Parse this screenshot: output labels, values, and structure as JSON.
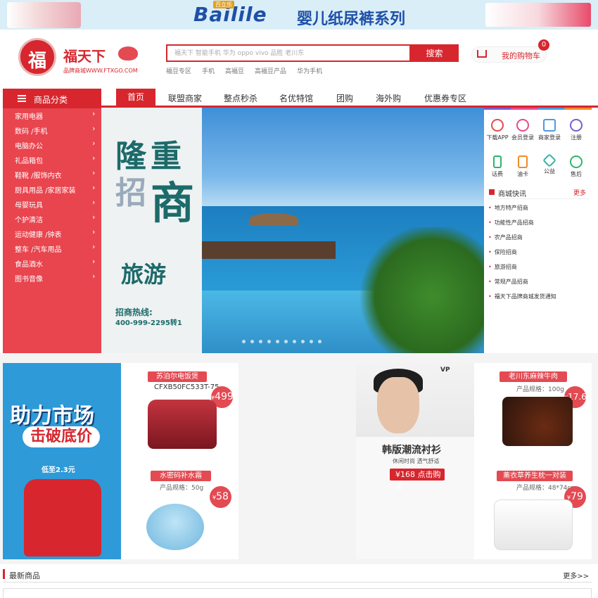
{
  "banner": {
    "brand": "Bailile",
    "brand_sub": "百立乐",
    "slogan": "婴儿纸尿裤系列"
  },
  "header": {
    "logo_char": "福",
    "logo_name": "福天下",
    "logo_sub": "品牌商城WWW.FTXGO.COM",
    "search_placeholder": "福天下 智能手机 华为 oppo vivo 品胜 老川东",
    "search_button": "搜索",
    "hot_links": [
      "福豆专区",
      "手机",
      "高福豆",
      "高福豆产品",
      "华为手机"
    ],
    "cart_label": "我的购物车",
    "cart_count": "0"
  },
  "nav": {
    "category_title": "商品分类",
    "home": "首页",
    "items": [
      "联盟商家",
      "整点秒杀",
      "名优特馆",
      "团购",
      "海外购",
      "优惠券专区"
    ]
  },
  "categories": [
    "家用电器",
    "数码 /手机",
    "电脑办公",
    "礼品箱包",
    "鞋靴 /服饰内衣",
    "厨具用品 /家居家装",
    "母婴玩具",
    "个护清洁",
    "运动健康 /钟表",
    "整车 /汽车用品",
    "食品酒水",
    "图书音像"
  ],
  "hero": {
    "title_a": "隆",
    "title_b": "招",
    "title_c": "重",
    "title_d": "商",
    "subtitle": "旅游",
    "hotline_label": "招商热线:",
    "hotline_number": "400-999-2295转1",
    "dot_count": 10
  },
  "right_panel": {
    "quick": [
      {
        "label": "下载APP",
        "icon": "cloud-download-icon",
        "color": "#e34a52"
      },
      {
        "label": "会员登录",
        "icon": "user-icon",
        "color": "#e84a8c"
      },
      {
        "label": "商家登录",
        "icon": "store-icon",
        "color": "#4c9be0"
      },
      {
        "label": "注册",
        "icon": "user-plus-icon",
        "color": "#7b5bd6"
      },
      {
        "label": "话费",
        "icon": "phone-icon",
        "color": "#2fb56b"
      },
      {
        "label": "油卡",
        "icon": "fuel-card-icon",
        "color": "#f08a2a"
      },
      {
        "label": "公益",
        "icon": "charity-icon",
        "color": "#2fb5a8"
      },
      {
        "label": "售后",
        "icon": "headset-icon",
        "color": "#2fb56b"
      }
    ],
    "news_title": "商城快讯",
    "news_more": "更多",
    "news": [
      "地方特产招商",
      "功能性产品招商",
      "农产品招商",
      "保险招商",
      "旅游招商",
      "常规产品招商",
      "福天下品牌商城发货通知"
    ]
  },
  "promos": {
    "promo1": {
      "line1": "助力市场",
      "line2": "击破底价",
      "line3": "低至2.3元"
    },
    "card1": {
      "top_name": "苏泊尔电饭煲",
      "top_model": "CFXB50FC533T-75",
      "top_price": "499",
      "bottom_name": "水密码补水霜",
      "bottom_spec": "产品规格：50g",
      "bottom_price": "58"
    },
    "promo3": {
      "title": "韩版潮流衬衫",
      "sub": "休闲时尚 透气舒适",
      "price": "¥168 点击购买",
      "logo": "VP"
    },
    "card4": {
      "top_name": "老川东麻辣牛肉",
      "top_spec": "产品规格：100g",
      "top_price": "17.6",
      "bottom_name": "薰衣草养生枕一对装",
      "bottom_spec": "产品规格：48*74cm",
      "bottom_price": "79"
    },
    "currency": "¥"
  },
  "new_section": {
    "title": "最新商品",
    "more": "更多>>"
  }
}
